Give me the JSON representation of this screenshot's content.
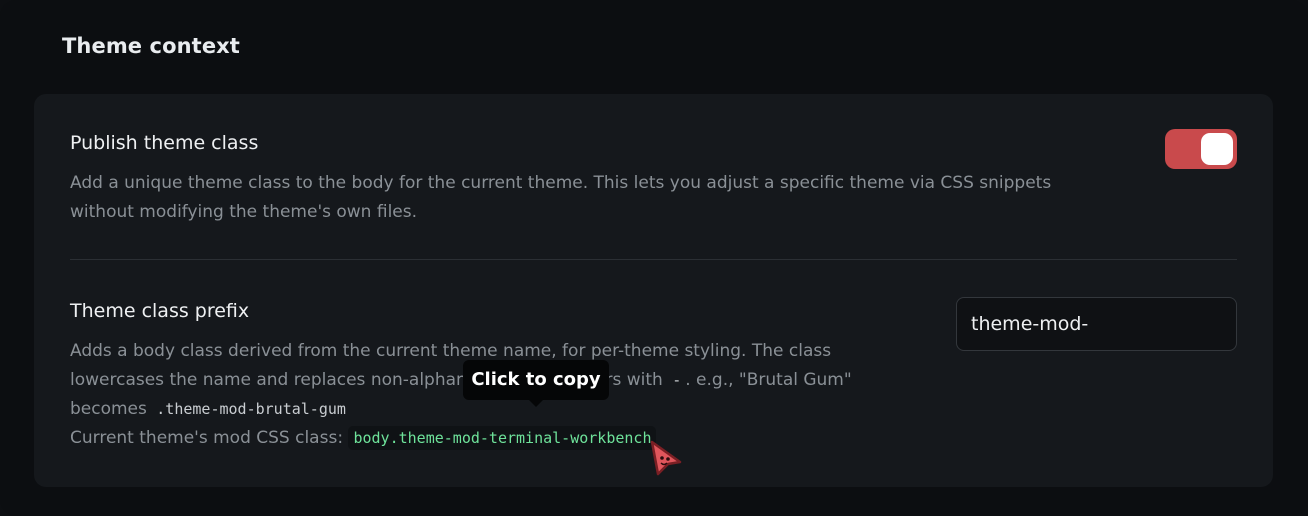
{
  "section": {
    "title": "Theme context"
  },
  "publish": {
    "label": "Publish theme class",
    "desc_line1": "Add a unique theme class to the body for the current theme. This lets you adjust a specific theme via CSS snippets",
    "desc_line2": "without modifying the theme's own files.",
    "toggle_on": true
  },
  "prefix": {
    "label": "Theme class prefix",
    "desc_line1": "Adds a body class derived from the current theme name, for per-theme styling. The class",
    "desc_line2_a": "lowercases the name and replaces non-alphanumeric characters with",
    "desc_line2_code": "-",
    "desc_line2_b": ". e.g., \"Brutal Gum\"",
    "desc_line3_a": "becomes",
    "desc_line3_code": ".theme-mod-brutal-gum",
    "current_label": "Current theme's mod CSS class:",
    "current_class": "body.theme-mod-terminal-workbench",
    "input_value": "theme-mod-"
  },
  "tooltip": {
    "text": "Click to copy"
  },
  "colors": {
    "accent": "#c94a4c",
    "code_green": "#6ee29a"
  },
  "icons": {
    "cursor": "mascot-cursor-icon"
  }
}
